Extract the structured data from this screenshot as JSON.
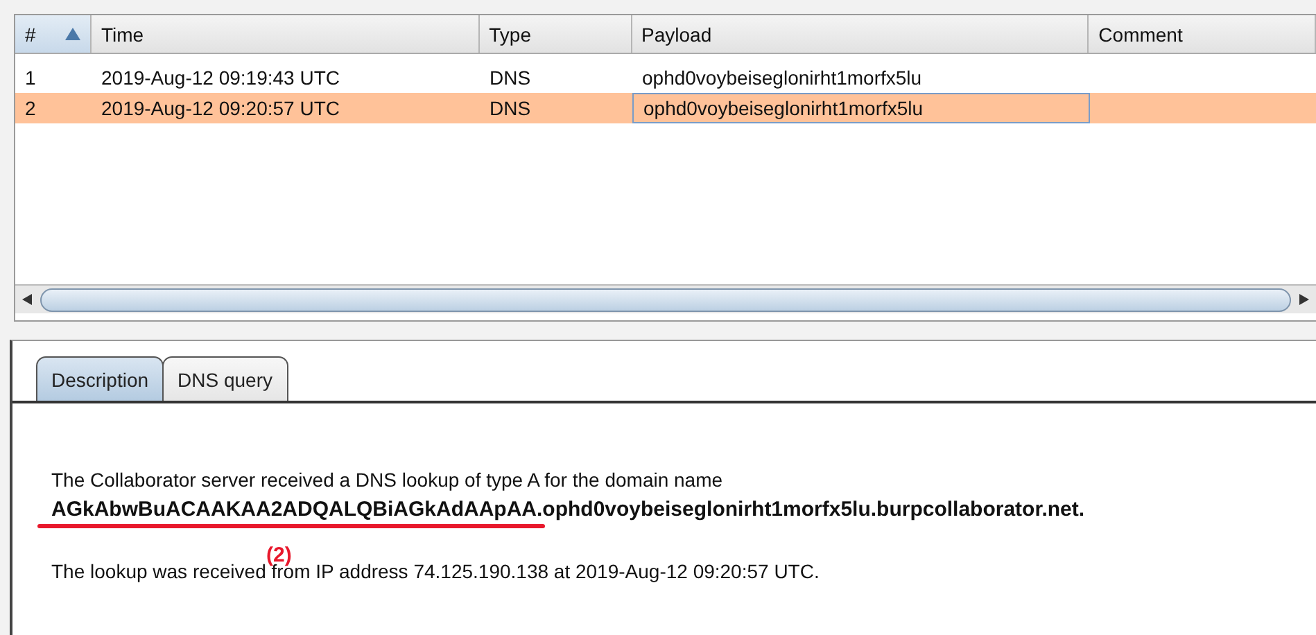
{
  "table": {
    "columns": [
      {
        "label": "#",
        "sorted": true
      },
      {
        "label": "Time",
        "sorted": false
      },
      {
        "label": "Type",
        "sorted": false
      },
      {
        "label": "Payload",
        "sorted": false
      },
      {
        "label": "Comment",
        "sorted": false
      }
    ],
    "rows": [
      {
        "number": "1",
        "time": "2019-Aug-12 09:19:43 UTC",
        "type": "DNS",
        "payload": "ophd0voybeiseglonirht1morfx5lu",
        "selected": false,
        "payload_focused": false
      },
      {
        "number": "2",
        "time": "2019-Aug-12 09:20:57 UTC",
        "type": "DNS",
        "payload": "ophd0voybeiseglonirht1morfx5lu",
        "selected": true,
        "payload_focused": true
      }
    ]
  },
  "tabs": [
    {
      "label": "Description",
      "selected": true
    },
    {
      "label": "DNS query",
      "selected": false
    }
  ],
  "description": {
    "intro": "The Collaborator server received a DNS lookup of type A for the domain name",
    "domain_marked": "AGkAbwBuACAAKAA2ADQALQBiAGkAdAApAA.",
    "domain_rest": "ophd0voybeiseglonirht1morfx5lu.burpcollaborator.net.",
    "annotation": "(2)",
    "source": "The lookup was received from IP address 74.125.190.138 at 2019-Aug-12 09:20:57 UTC."
  }
}
